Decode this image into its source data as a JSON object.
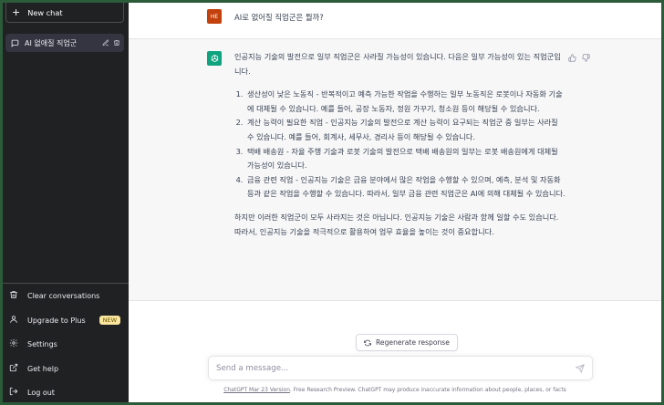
{
  "sidebar": {
    "new_chat_label": "New chat",
    "conversations": [
      {
        "title": "AI 없애질 직업군"
      }
    ],
    "menu": {
      "clear": "Clear conversations",
      "upgrade": "Upgrade to Plus",
      "upgrade_badge": "NEW",
      "settings": "Settings",
      "help": "Get help",
      "logout": "Log out"
    }
  },
  "thread": {
    "user_initials": "HE",
    "user_message": "AI로 없어질 직업군은 뭘까?",
    "assistant": {
      "intro": "인공지능 기술의 발전으로 일부 직업군은 사라질 가능성이 있습니다. 다음은 일부 가능성이 있는 직업군입니다.",
      "items": [
        "생산성이 낮은 노동직 - 반복적이고 예측 가능한 작업을 수행하는 일부 노동직은 로봇이나 자동화 기술에 대체될 수 있습니다. 예를 들어, 공장 노동자, 정원 가꾸기, 청소원 등이 해당될 수 있습니다.",
        "계산 능력이 필요한 직업 - 인공지능 기술의 발전으로 계산 능력이 요구되는 직업군 중 일부는 사라질 수 있습니다. 예를 들어, 회계사, 세무사, 경리사 등이 해당될 수 있습니다.",
        "택배 배송원 - 자율 주행 기술과 로봇 기술의 발전으로 택배 배송원의 일부는 로봇 배송원에게 대체될 가능성이 있습니다.",
        "금융 관련 직업 - 인공지능 기술은 금융 분야에서 많은 작업을 수행할 수 있으며, 예측, 분석 및 자동화 등과 같은 작업을 수행할 수 있습니다. 따라서, 일부 금융 관련 직업군은 AI에 의해 대체될 수 있습니다."
      ],
      "conclusion": "하지만 이러한 직업군이 모두 사라지는 것은 아닙니다. 인공지능 기술은 사람과 함께 일할 수도 있습니다. 따라서, 인공지능 기술을 적극적으로 활용하여 업무 효율을 높이는 것이 중요합니다."
    }
  },
  "regenerate_label": "Regenerate response",
  "composer": {
    "placeholder": "Send a message..."
  },
  "footer": {
    "version_link": "ChatGPT Mar 23 Version",
    "text": ". Free Research Preview. ChatGPT may produce inaccurate information about people, places, or facts"
  },
  "colors": {
    "sidebar_bg": "#202123",
    "accent": "#10a37f",
    "user_avatar": "#c2410c",
    "background_border": "#2b5b39"
  }
}
